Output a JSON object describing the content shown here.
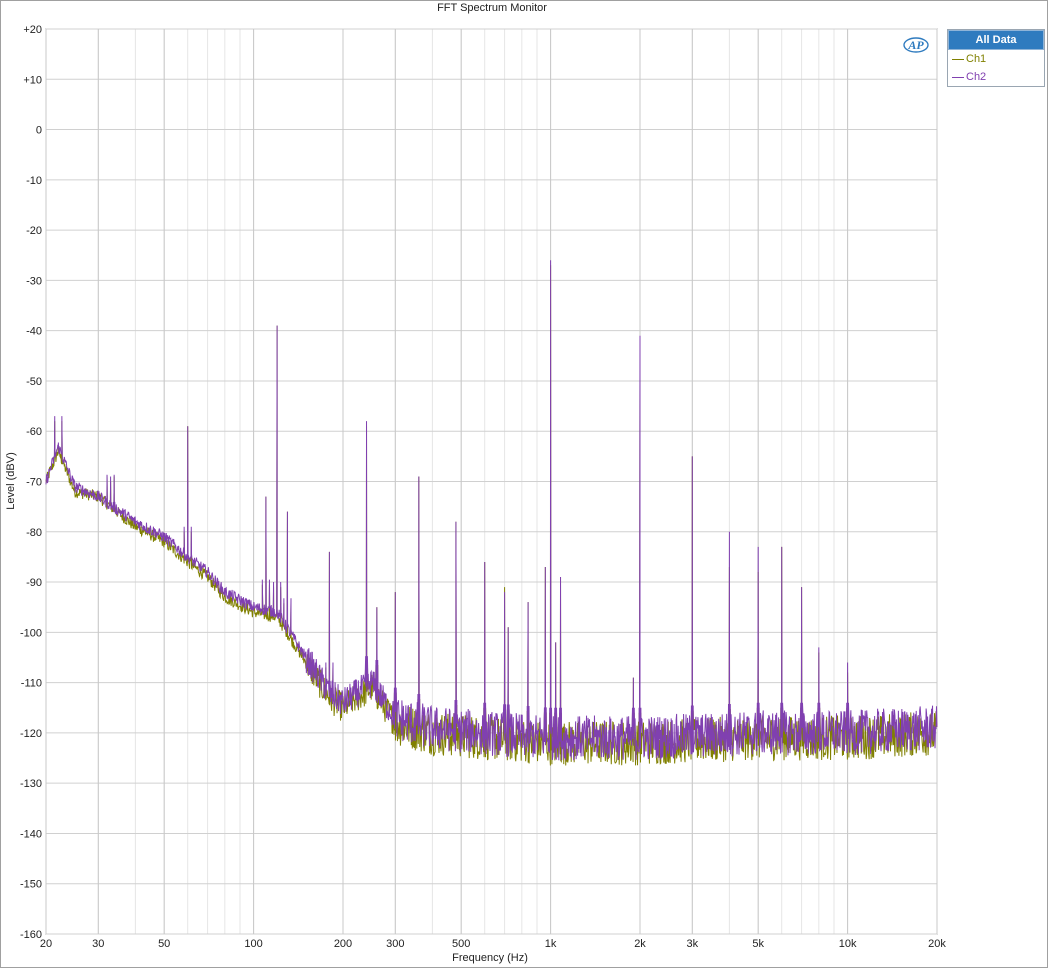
{
  "window": {
    "title": "FFT Spectrum Monitor"
  },
  "legend": {
    "header": "All Data",
    "items": [
      {
        "label": "Ch1",
        "color": "#808000"
      },
      {
        "label": "Ch2",
        "color": "#8040b0"
      }
    ]
  },
  "logo": {
    "icon": "ap-logo-icon",
    "color": "#2f7bbf"
  },
  "chart_data": {
    "type": "line",
    "title": "FFT Spectrum Monitor",
    "xlabel": "Frequency (Hz)",
    "ylabel": "Level (dBV)",
    "xscale": "log",
    "xlim": [
      20,
      20000
    ],
    "ylim": [
      -160,
      20
    ],
    "grid": true,
    "legend_position": "top-right, outside plot",
    "x_ticks": [
      20,
      30,
      50,
      100,
      200,
      300,
      500,
      1000,
      2000,
      3000,
      5000,
      10000,
      20000
    ],
    "x_tick_labels": [
      "20",
      "30",
      "50",
      "100",
      "200",
      "300",
      "500",
      "1k",
      "2k",
      "3k",
      "5k",
      "10k",
      "20k"
    ],
    "y_ticks": [
      20,
      10,
      0,
      -10,
      -20,
      -30,
      -40,
      -50,
      -60,
      -70,
      -80,
      -90,
      -100,
      -110,
      -120,
      -130,
      -140,
      -150,
      -160
    ],
    "y_tick_labels": [
      "+20",
      "+10",
      "0",
      "-10",
      "-20",
      "-30",
      "-40",
      "-50",
      "-60",
      "-70",
      "-80",
      "-90",
      "-100",
      "-110",
      "-120",
      "-130",
      "-140",
      "-150",
      "-160"
    ],
    "series": [
      {
        "name": "Ch1",
        "color": "#808000",
        "floor": [
          [
            20,
            -70
          ],
          [
            22,
            -64
          ],
          [
            25,
            -72
          ],
          [
            30,
            -73
          ],
          [
            40,
            -79
          ],
          [
            50,
            -82
          ],
          [
            60,
            -86
          ],
          [
            70,
            -89
          ],
          [
            80,
            -93
          ],
          [
            100,
            -96
          ],
          [
            120,
            -97
          ],
          [
            150,
            -106
          ],
          [
            180,
            -113
          ],
          [
            200,
            -115
          ],
          [
            250,
            -111
          ],
          [
            300,
            -118
          ],
          [
            400,
            -120
          ],
          [
            600,
            -121
          ],
          [
            1000,
            -122
          ],
          [
            2000,
            -122
          ],
          [
            5000,
            -121
          ],
          [
            10000,
            -121
          ],
          [
            20000,
            -120
          ]
        ],
        "peaks": [
          [
            22,
            -63
          ],
          [
            33,
            -70
          ],
          [
            60,
            -59
          ],
          [
            110,
            -73
          ],
          [
            120,
            -39
          ],
          [
            130,
            -76
          ],
          [
            180,
            -84
          ],
          [
            240,
            -59
          ],
          [
            260,
            -95
          ],
          [
            300,
            -92
          ],
          [
            360,
            -69
          ],
          [
            480,
            -78
          ],
          [
            600,
            -86
          ],
          [
            700,
            -91
          ],
          [
            720,
            -99
          ],
          [
            840,
            -94
          ],
          [
            960,
            -87
          ],
          [
            1000,
            -27
          ],
          [
            1040,
            -102
          ],
          [
            1080,
            -89
          ],
          [
            1900,
            -109
          ],
          [
            2000,
            -50
          ],
          [
            3000,
            -65
          ],
          [
            4000,
            -87
          ],
          [
            5000,
            -88
          ],
          [
            6000,
            -83
          ],
          [
            7000,
            -91
          ],
          [
            8000,
            -104
          ],
          [
            10000,
            -108
          ]
        ]
      },
      {
        "name": "Ch2",
        "color": "#8040b0",
        "floor": [
          [
            20,
            -70
          ],
          [
            22,
            -63
          ],
          [
            25,
            -71
          ],
          [
            30,
            -73
          ],
          [
            40,
            -78
          ],
          [
            50,
            -81
          ],
          [
            60,
            -85
          ],
          [
            70,
            -88
          ],
          [
            80,
            -92
          ],
          [
            100,
            -95
          ],
          [
            120,
            -96
          ],
          [
            150,
            -105
          ],
          [
            180,
            -112
          ],
          [
            200,
            -114
          ],
          [
            250,
            -110
          ],
          [
            300,
            -117
          ],
          [
            400,
            -119
          ],
          [
            600,
            -120
          ],
          [
            1000,
            -121
          ],
          [
            2000,
            -121
          ],
          [
            5000,
            -120
          ],
          [
            10000,
            -120
          ],
          [
            20000,
            -119
          ]
        ],
        "peaks": [
          [
            22,
            -63
          ],
          [
            33,
            -69
          ],
          [
            60,
            -59
          ],
          [
            110,
            -73
          ],
          [
            120,
            -39
          ],
          [
            130,
            -76
          ],
          [
            180,
            -84
          ],
          [
            240,
            -58
          ],
          [
            260,
            -95
          ],
          [
            300,
            -92
          ],
          [
            360,
            -69
          ],
          [
            480,
            -78
          ],
          [
            600,
            -86
          ],
          [
            700,
            -92
          ],
          [
            720,
            -99
          ],
          [
            840,
            -94
          ],
          [
            960,
            -87
          ],
          [
            1000,
            -26
          ],
          [
            1040,
            -102
          ],
          [
            1080,
            -89
          ],
          [
            1900,
            -109
          ],
          [
            2000,
            -41
          ],
          [
            3000,
            -65
          ],
          [
            4000,
            -80
          ],
          [
            5000,
            -83
          ],
          [
            6000,
            -83
          ],
          [
            7000,
            -91
          ],
          [
            8000,
            -103
          ],
          [
            10000,
            -106
          ]
        ]
      }
    ]
  }
}
